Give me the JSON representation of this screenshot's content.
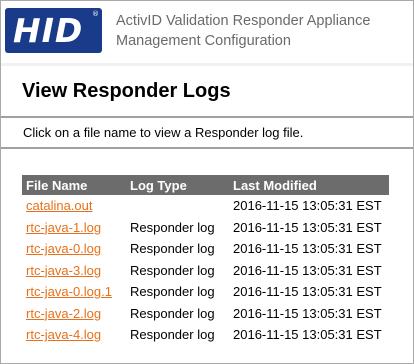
{
  "header": {
    "logo_text": "HID",
    "logo_reg": "®",
    "title_line1": "ActivID Validation Responder Appliance",
    "title_line2": "Management Configuration",
    "colors": {
      "logo_bg": "#1a3a8a",
      "title_text": "#6a6a6a"
    }
  },
  "page": {
    "title": "View Responder Logs",
    "instructions": "Click on a file name to view a Responder log file."
  },
  "table": {
    "columns": [
      "File Name",
      "Log Type",
      "Last Modified"
    ],
    "rows": [
      {
        "file": "catalina.out",
        "type": "",
        "modified": "2016-11-15 13:05:31 EST"
      },
      {
        "file": "rtc-java-1.log",
        "type": "Responder log",
        "modified": "2016-11-15 13:05:31 EST"
      },
      {
        "file": "rtc-java-0.log",
        "type": "Responder log",
        "modified": "2016-11-15 13:05:31 EST"
      },
      {
        "file": "rtc-java-3.log",
        "type": "Responder log",
        "modified": "2016-11-15 13:05:31 EST"
      },
      {
        "file": "rtc-java-0.log.1",
        "type": "Responder log",
        "modified": "2016-11-15 13:05:31 EST"
      },
      {
        "file": "rtc-java-2.log",
        "type": "Responder log",
        "modified": "2016-11-15 13:05:31 EST"
      },
      {
        "file": "rtc-java-4.log",
        "type": "Responder log",
        "modified": "2016-11-15 13:05:31 EST"
      }
    ],
    "colors": {
      "header_bg": "#6c6c6c",
      "link": "#e8701a"
    }
  }
}
